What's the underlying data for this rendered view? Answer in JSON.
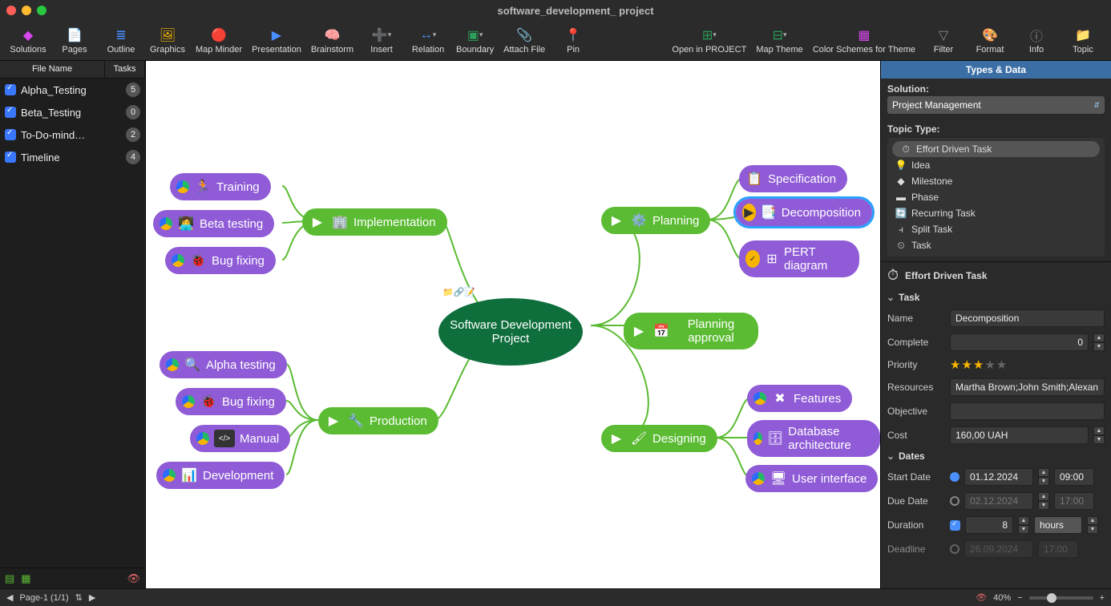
{
  "window": {
    "title": "software_development_ project"
  },
  "toolbar": [
    {
      "label": "Solutions",
      "icon": "◆",
      "c": "#d946ef"
    },
    {
      "label": "Pages",
      "icon": "📄",
      "c": "#4a90ff"
    },
    {
      "label": "Outline",
      "icon": "≣",
      "c": "#4a90ff"
    },
    {
      "label": "Graphics",
      "icon": "🖼",
      "c": "#f7b500"
    },
    {
      "label": "Map Minder",
      "icon": "🔴",
      "c": "#e55"
    },
    {
      "label": "Presentation",
      "icon": "▶",
      "c": "#4a90ff"
    },
    {
      "label": "Brainstorm",
      "icon": "🧠",
      "c": "#2aa05a"
    },
    {
      "label": "Insert",
      "icon": "➕",
      "c": "#2aa05a",
      "dd": true
    },
    {
      "label": "Relation",
      "icon": "↔",
      "c": "#4a90ff",
      "dd": true
    },
    {
      "label": "Boundary",
      "icon": "▣",
      "c": "#2aa05a",
      "dd": true
    },
    {
      "label": "Attach File",
      "icon": "📎",
      "c": "#aaa"
    },
    {
      "label": "Pin",
      "icon": "📍",
      "c": "#e55"
    }
  ],
  "toolbar_right": [
    {
      "label": "Open in PROJECT",
      "icon": "⊞",
      "c": "#2aa05a",
      "dd": true
    },
    {
      "label": "Map Theme",
      "icon": "⊟",
      "c": "#2aa05a",
      "dd": true
    },
    {
      "label": "Color Schemes for Theme",
      "icon": "▦",
      "c": "#d946ef"
    },
    {
      "label": "Filter",
      "icon": "▽",
      "c": "#888"
    },
    {
      "label": "Format",
      "icon": "🎨",
      "c": "#888"
    },
    {
      "label": "Info",
      "icon": "ⓘ",
      "c": "#888"
    },
    {
      "label": "Topic",
      "icon": "📁",
      "c": "#888"
    }
  ],
  "files": {
    "headers": {
      "name": "File Name",
      "tasks": "Tasks"
    },
    "rows": [
      {
        "name": "Alpha_Testing",
        "count": "5"
      },
      {
        "name": "Beta_Testing",
        "count": "0"
      },
      {
        "name": "To-Do-mind…",
        "count": "2"
      },
      {
        "name": "Timeline",
        "count": "4"
      }
    ]
  },
  "mindmap": {
    "center": "Software Development Project",
    "branches": {
      "implementation": {
        "label": "Implementation",
        "children": [
          {
            "label": "Training",
            "icon": "🏃"
          },
          {
            "label": "Beta testing",
            "icon": "👩‍💻"
          },
          {
            "label": "Bug fixing",
            "icon": "🐞"
          }
        ]
      },
      "production": {
        "label": "Production",
        "children": [
          {
            "label": "Alpha testing",
            "icon": "🔍"
          },
          {
            "label": "Bug fixing",
            "icon": "🐞"
          },
          {
            "label": "Manual",
            "icon": "</>"
          },
          {
            "label": "Development",
            "icon": "📊"
          }
        ]
      },
      "planning": {
        "label": "Planning",
        "children": [
          {
            "label": "Specification",
            "icon": "📋"
          },
          {
            "label": "Decomposition",
            "icon": "📑",
            "sel": true
          },
          {
            "label": "PERT diagram",
            "icon": "⊞"
          }
        ]
      },
      "approval": {
        "label": "Planning approval",
        "icon": "📅"
      },
      "designing": {
        "label": "Designing",
        "children": [
          {
            "label": "Features",
            "icon": "✖"
          },
          {
            "label": "Database architecture",
            "icon": "🗄"
          },
          {
            "label": "User interface",
            "icon": "🖥"
          }
        ]
      }
    }
  },
  "panel": {
    "title": "Types & Data",
    "solution_label": "Solution:",
    "solution_value": "Project Management",
    "topic_type_label": "Topic Type:",
    "types": [
      {
        "label": "Effort Driven Task",
        "icon": "⏱",
        "sel": true
      },
      {
        "label": "Idea",
        "icon": "💡"
      },
      {
        "label": "Milestone",
        "icon": "◆"
      },
      {
        "label": "Phase",
        "icon": "▬"
      },
      {
        "label": "Recurring Task",
        "icon": "🔄"
      },
      {
        "label": "Split Task",
        "icon": "⫞"
      },
      {
        "label": "Task",
        "icon": "⏲"
      }
    ],
    "selected_type": "Effort Driven Task",
    "task_section": "Task",
    "fields": {
      "name": {
        "label": "Name",
        "value": "Decomposition"
      },
      "complete": {
        "label": "Complete",
        "value": "0"
      },
      "priority": {
        "label": "Priority",
        "stars": 3,
        "max": 5
      },
      "resources": {
        "label": "Resources",
        "value": "Martha Brown;John Smith;Alexan"
      },
      "objective": {
        "label": "Objective",
        "value": ""
      },
      "cost": {
        "label": "Cost",
        "value": "160,00 UAH"
      }
    },
    "dates_section": "Dates",
    "dates": {
      "start": {
        "label": "Start Date",
        "date": "01.12.2024",
        "time": "09:00",
        "on": true
      },
      "due": {
        "label": "Due Date",
        "date": "02.12.2024",
        "time": "17:00",
        "on": false
      },
      "duration": {
        "label": "Duration",
        "value": "8",
        "unit": "hours",
        "chk": true
      },
      "deadline": {
        "label": "Deadline",
        "date": "26.09.2024",
        "time": "17:00",
        "on": false
      }
    }
  },
  "status": {
    "page": "Page-1 (1/1)",
    "zoom": "40%"
  }
}
